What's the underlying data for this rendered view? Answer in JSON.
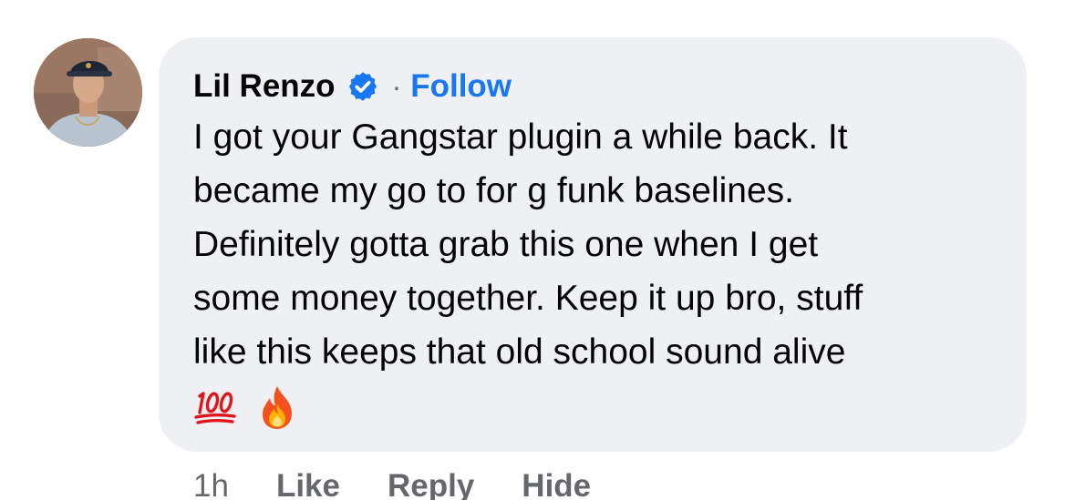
{
  "comment": {
    "author": "Lil Renzo",
    "separator": "·",
    "follow_label": "Follow",
    "verified_icon": "verified-badge-icon",
    "text": "I got your Gangstar plugin a while back. It became my go to for g funk baselines. Definitely gotta grab this one when I get some money together. Keep it up bro, stuff like this keeps that old school sound alive",
    "lines": [
      "I got your Gangstar plugin a while back. It",
      "became my go to for g funk baselines.",
      "Definitely gotta grab this one when I get",
      "some money together. Keep it up bro, stuff",
      "like this keeps that old school sound alive"
    ],
    "emojis": [
      "hundred-points-emoji",
      "fire-emoji"
    ]
  },
  "actions": {
    "time": "1h",
    "like_label": "Like",
    "reply_label": "Reply",
    "hide_label": "Hide"
  },
  "colors": {
    "bubble_bg": "#eff0f4",
    "link_blue": "#1877f2",
    "secondary_text": "#65676b",
    "primary_text": "#050505"
  }
}
